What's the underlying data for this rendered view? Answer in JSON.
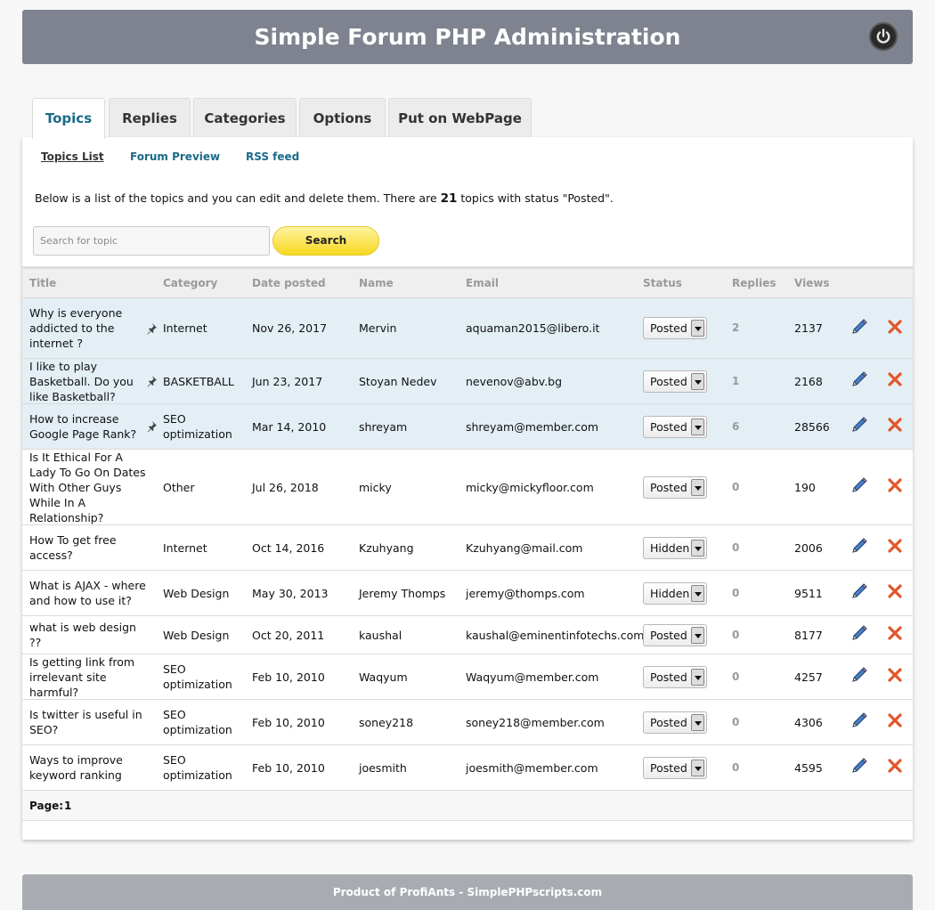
{
  "header": {
    "title": "Simple Forum PHP Administration",
    "logout_icon": "power-icon"
  },
  "tabs": [
    {
      "label": "Topics",
      "active": true
    },
    {
      "label": "Replies"
    },
    {
      "label": "Categories"
    },
    {
      "label": "Options"
    },
    {
      "label": "Put on WebPage"
    }
  ],
  "sublinks": [
    {
      "label": "Topics List",
      "active": true
    },
    {
      "label": "Forum Preview"
    },
    {
      "label": "RSS feed"
    }
  ],
  "intro": {
    "before": "Below is a list of the topics and you can edit and delete them. There are ",
    "count": "21",
    "after": " topics with status \"Posted\"."
  },
  "search": {
    "placeholder": "Search for topic",
    "button_label": "Search"
  },
  "columns": [
    "Title",
    "Category",
    "Date posted",
    "Name",
    "Email",
    "Status",
    "Replies",
    "Views"
  ],
  "rows": [
    {
      "title": "Why is everyone addicted to the internet ?",
      "pinned": true,
      "category": "Internet",
      "date": "Nov 26, 2017",
      "name": "Mervin",
      "email": "aquaman2015@libero.it",
      "status": "Posted",
      "replies": "2",
      "views": "2137"
    },
    {
      "title": "I like to play Basketball. Do you like Basketball?",
      "pinned": true,
      "category": "BASKETBALL",
      "date": "Jun 23, 2017",
      "name": "Stoyan Nedev",
      "email": "nevenov@abv.bg",
      "status": "Posted",
      "replies": "1",
      "views": "2168"
    },
    {
      "title": "How to increase Google Page Rank?",
      "pinned": true,
      "category": "SEO optimization",
      "date": "Mar 14, 2010",
      "name": "shreyam",
      "email": "shreyam@member.com",
      "status": "Posted",
      "replies": "6",
      "views": "28566"
    },
    {
      "title": "Is It Ethical For A Lady To Go On Dates With Other Guys While In A Relationship?",
      "pinned": false,
      "category": "Other",
      "date": "Jul 26, 2018",
      "name": "micky",
      "email": "micky@mickyfloor.com",
      "status": "Posted",
      "replies": "0",
      "views": "190"
    },
    {
      "title": "How To get free access?",
      "pinned": false,
      "category": "Internet",
      "date": "Oct 14, 2016",
      "name": "Kzuhyang",
      "email": "Kzuhyang@mail.com",
      "status": "Hidden",
      "replies": "0",
      "views": "2006"
    },
    {
      "title": "What is AJAX - where and how to use it?",
      "pinned": false,
      "category": "Web Design",
      "date": "May 30, 2013",
      "name": "Jeremy Thomps",
      "email": "jeremy@thomps.com",
      "status": "Hidden",
      "replies": "0",
      "views": "9511"
    },
    {
      "title": "what is web design ??",
      "pinned": false,
      "category": "Web Design",
      "date": "Oct 20, 2011",
      "name": "kaushal",
      "email": "kaushal@eminentinfotechs.com",
      "status": "Posted",
      "replies": "0",
      "views": "8177"
    },
    {
      "title": "Is getting link from irrelevant site harmful?",
      "pinned": false,
      "category": "SEO optimization",
      "date": "Feb 10, 2010",
      "name": "Waqyum",
      "email": "Waqyum@member.com",
      "status": "Posted",
      "replies": "0",
      "views": "4257"
    },
    {
      "title": "Is twitter is useful in SEO?",
      "pinned": false,
      "category": "SEO optimization",
      "date": "Feb 10, 2010",
      "name": "soney218",
      "email": "soney218@member.com",
      "status": "Posted",
      "replies": "0",
      "views": "4306"
    },
    {
      "title": "Ways to improve keyword ranking",
      "pinned": false,
      "category": "SEO optimization",
      "date": "Feb 10, 2010",
      "name": "joesmith",
      "email": "joesmith@member.com",
      "status": "Posted",
      "replies": "0",
      "views": "4595"
    }
  ],
  "pager": {
    "label": "Page:",
    "pages": [
      "1"
    ]
  },
  "footer": {
    "text": "Product of ProfiAnts - SimplePHPscripts.com"
  },
  "colors": {
    "header_bg": "#7e838f",
    "accent": "#1c6a88",
    "pinned_row": "#e3eef5",
    "search_btn": "#f7d820",
    "delete": "#e2562b"
  },
  "icons": {
    "pin": "pin-icon",
    "edit": "pencil-icon",
    "delete": "close-icon"
  }
}
